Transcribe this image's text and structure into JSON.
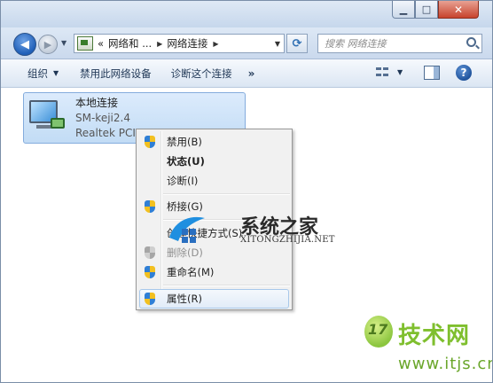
{
  "address_bar": {
    "crumbs": [
      "网络和 ...",
      "网络连接"
    ],
    "prefix": "«"
  },
  "search": {
    "placeholder": "搜索 网络连接"
  },
  "command_bar": {
    "organize": "组织",
    "disable_device": "禁用此网络设备",
    "diagnose": "诊断这个连接",
    "more": "»"
  },
  "connection": {
    "name": "本地连接",
    "network": "SM-keji2.4",
    "adapter": "Realtek PCIe"
  },
  "context_menu": {
    "items": [
      {
        "label": "禁用(B)",
        "shield": true,
        "style": "normal"
      },
      {
        "label": "状态(U)",
        "shield": false,
        "style": "bold"
      },
      {
        "label": "诊断(I)",
        "shield": false,
        "style": "normal"
      },
      {
        "label": "桥接(G)",
        "shield": true,
        "style": "normal"
      },
      {
        "label": "创建快捷方式(S)",
        "shield": false,
        "style": "normal"
      },
      {
        "label": "删除(D)",
        "shield": true,
        "style": "disabled"
      },
      {
        "label": "重命名(M)",
        "shield": true,
        "style": "normal"
      },
      {
        "label": "属性(R)",
        "shield": true,
        "style": "hover"
      }
    ]
  },
  "watermarks": {
    "site_title": "系统之家",
    "site_sub": "XITONGZHIJIA.NET",
    "badge_num": "17",
    "badge_title": "技术网",
    "badge_url": "www.itjs.cn"
  },
  "colors": {
    "accent": "#2f7fd6",
    "menu_bg": "#f1f1f1",
    "selection": "#c2dcf5",
    "badge_green": "#7fbf2e"
  }
}
